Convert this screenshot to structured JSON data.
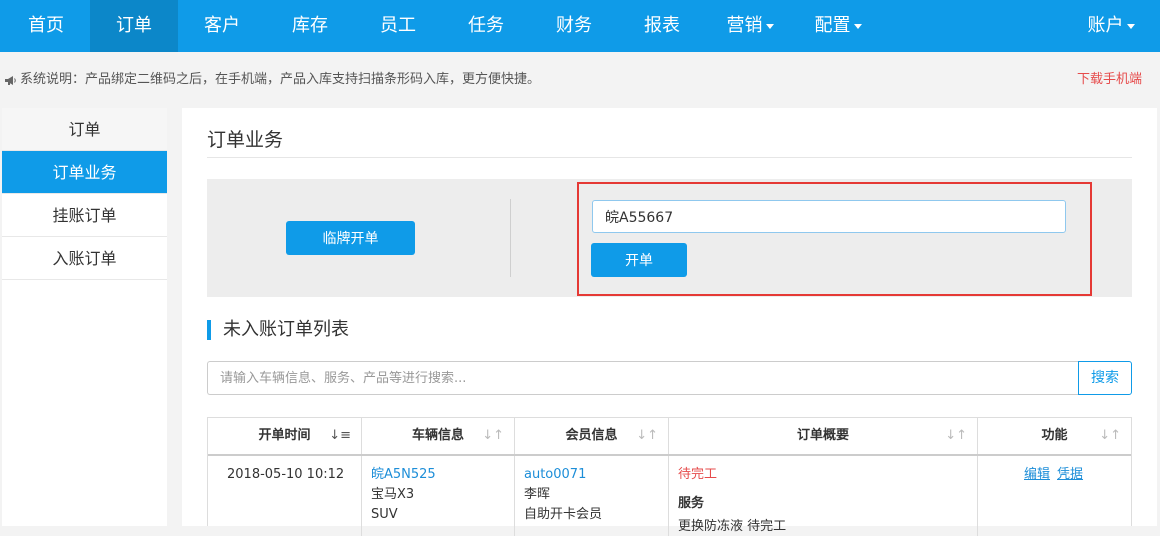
{
  "nav": {
    "items": [
      {
        "label": "首页"
      },
      {
        "label": "订单"
      },
      {
        "label": "客户"
      },
      {
        "label": "库存"
      },
      {
        "label": "员工"
      },
      {
        "label": "任务"
      },
      {
        "label": "财务"
      },
      {
        "label": "报表"
      },
      {
        "label": "营销"
      },
      {
        "label": "配置"
      }
    ],
    "account": "账户"
  },
  "notice": {
    "text": "系统说明：产品绑定二维码之后，在手机端，产品入库支持扫描条形码入库，更方便快捷。",
    "download": "下载手机端"
  },
  "sidebar": {
    "title": "订单",
    "items": [
      {
        "label": "订单业务"
      },
      {
        "label": "挂账订单"
      },
      {
        "label": "入账订单"
      }
    ]
  },
  "main": {
    "title": "订单业务",
    "temp_plate_button": "临牌开单",
    "plate_input_value": "皖A55667",
    "open_button": "开单",
    "list_title": "未入账订单列表",
    "search_placeholder": "请输入车辆信息、服务、产品等进行搜索...",
    "search_button": "搜索"
  },
  "table": {
    "columns": [
      "开单时间",
      "车辆信息",
      "会员信息",
      "订单概要",
      "功能"
    ],
    "rows": [
      {
        "time": "2018-05-10 10:12",
        "plate": "皖A5N525",
        "car_model": "宝马X3",
        "car_type": "SUV",
        "member_id": "auto0071",
        "member_name": "李晖",
        "member_type": "自助开卡会员",
        "status": "待完工",
        "section": "服务",
        "service_partial": "更换防冻液 待完工",
        "actions": [
          "编辑",
          "凭据"
        ]
      }
    ]
  },
  "colors": {
    "primary": "#0f9be8",
    "highlight_border": "#e53935",
    "warning_text": "#e64b4b"
  }
}
